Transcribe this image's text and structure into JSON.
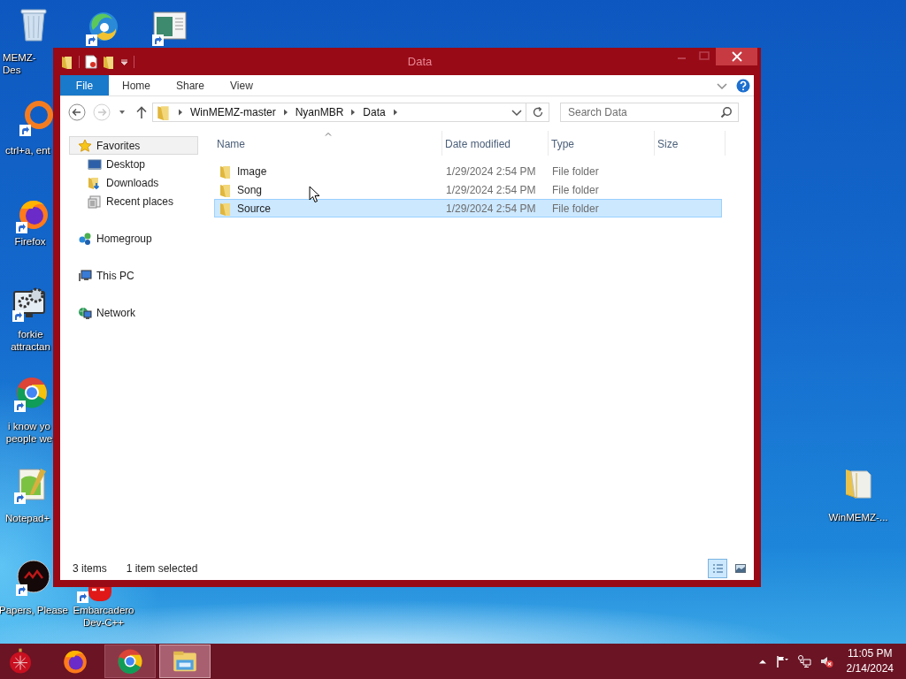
{
  "desktop": {
    "icons": [
      {
        "kind": "recycle-bin",
        "label": "MEMZ-Des",
        "shortcut": false
      },
      {
        "kind": "swirl",
        "shortcut": true
      },
      {
        "kind": "app-window",
        "shortcut": true
      },
      {
        "kind": "ring",
        "label": "ctrl+a, ent",
        "shortcut": true
      },
      {
        "kind": "flame-globe",
        "label": "Firefox",
        "shortcut": true
      },
      {
        "kind": "gear-monitor",
        "label": "forkie attractan",
        "shortcut": true
      },
      {
        "kind": "chrome",
        "label": "i know yo people we",
        "shortcut": true
      },
      {
        "kind": "notepad",
        "label": "Notepad+",
        "shortcut": true
      },
      {
        "kind": "dark-disc",
        "label": "Papers, Please",
        "shortcut": true
      },
      {
        "kind": "red-app",
        "label": "Embarcadero Dev-C++",
        "shortcut": true
      },
      {
        "kind": "folder",
        "label": "WinMEMZ-...",
        "shortcut": false
      }
    ]
  },
  "window": {
    "title": "Data",
    "ribbon_tabs": [
      {
        "label": "File",
        "kind": "file-menu"
      },
      {
        "label": "Home",
        "kind": "tab"
      },
      {
        "label": "Share",
        "kind": "tab"
      },
      {
        "label": "View",
        "kind": "tab"
      }
    ],
    "address": {
      "crumbs": [
        "WinMEMZ-master",
        "NyanMBR",
        "Data"
      ]
    },
    "search": {
      "placeholder": "Search Data"
    },
    "nav_pane": {
      "groups": [
        {
          "label": "Favorites",
          "kind": "star",
          "highlighted": true,
          "children": [
            {
              "label": "Desktop",
              "kind": "desktop",
              "highlighted": false
            },
            {
              "label": "Downloads",
              "kind": "downloads",
              "highlighted": false
            },
            {
              "label": "Recent places",
              "kind": "recent",
              "highlighted": false
            }
          ]
        },
        {
          "label": "Homegroup",
          "kind": "homegroup",
          "highlighted": false
        },
        {
          "label": "This PC",
          "kind": "pc",
          "highlighted": false
        },
        {
          "label": "Network",
          "kind": "network",
          "highlighted": false
        }
      ]
    },
    "columns": [
      {
        "label": "Name",
        "sorted": true
      },
      {
        "label": "Date modified",
        "sorted": false
      },
      {
        "label": "Type",
        "sorted": false
      },
      {
        "label": "Size",
        "sorted": false
      }
    ],
    "rows": [
      {
        "name": "Image",
        "date_modified": "1/29/2024 2:54 PM",
        "type": "File folder",
        "selected": false
      },
      {
        "name": "Song",
        "date_modified": "1/29/2024 2:54 PM",
        "type": "File folder",
        "selected": false
      },
      {
        "name": "Source",
        "date_modified": "1/29/2024 2:54 PM",
        "type": "File folder",
        "selected": true
      }
    ],
    "status_bar": {
      "item_count": "3 items",
      "selection": "1 item selected",
      "views": [
        {
          "kind": "details",
          "selected": true
        },
        {
          "kind": "large-icons",
          "selected": false
        }
      ]
    }
  },
  "taskbar": {
    "apps": [
      {
        "kind": "ornament",
        "open": false,
        "active": false
      },
      {
        "kind": "flame-globe",
        "open": false,
        "active": false
      },
      {
        "kind": "chrome",
        "open": true,
        "active": false
      },
      {
        "kind": "explorer",
        "open": true,
        "active": true
      }
    ],
    "tray": {
      "volume_muted": true,
      "time": "11:05 PM",
      "date": "2/14/2024"
    }
  }
}
